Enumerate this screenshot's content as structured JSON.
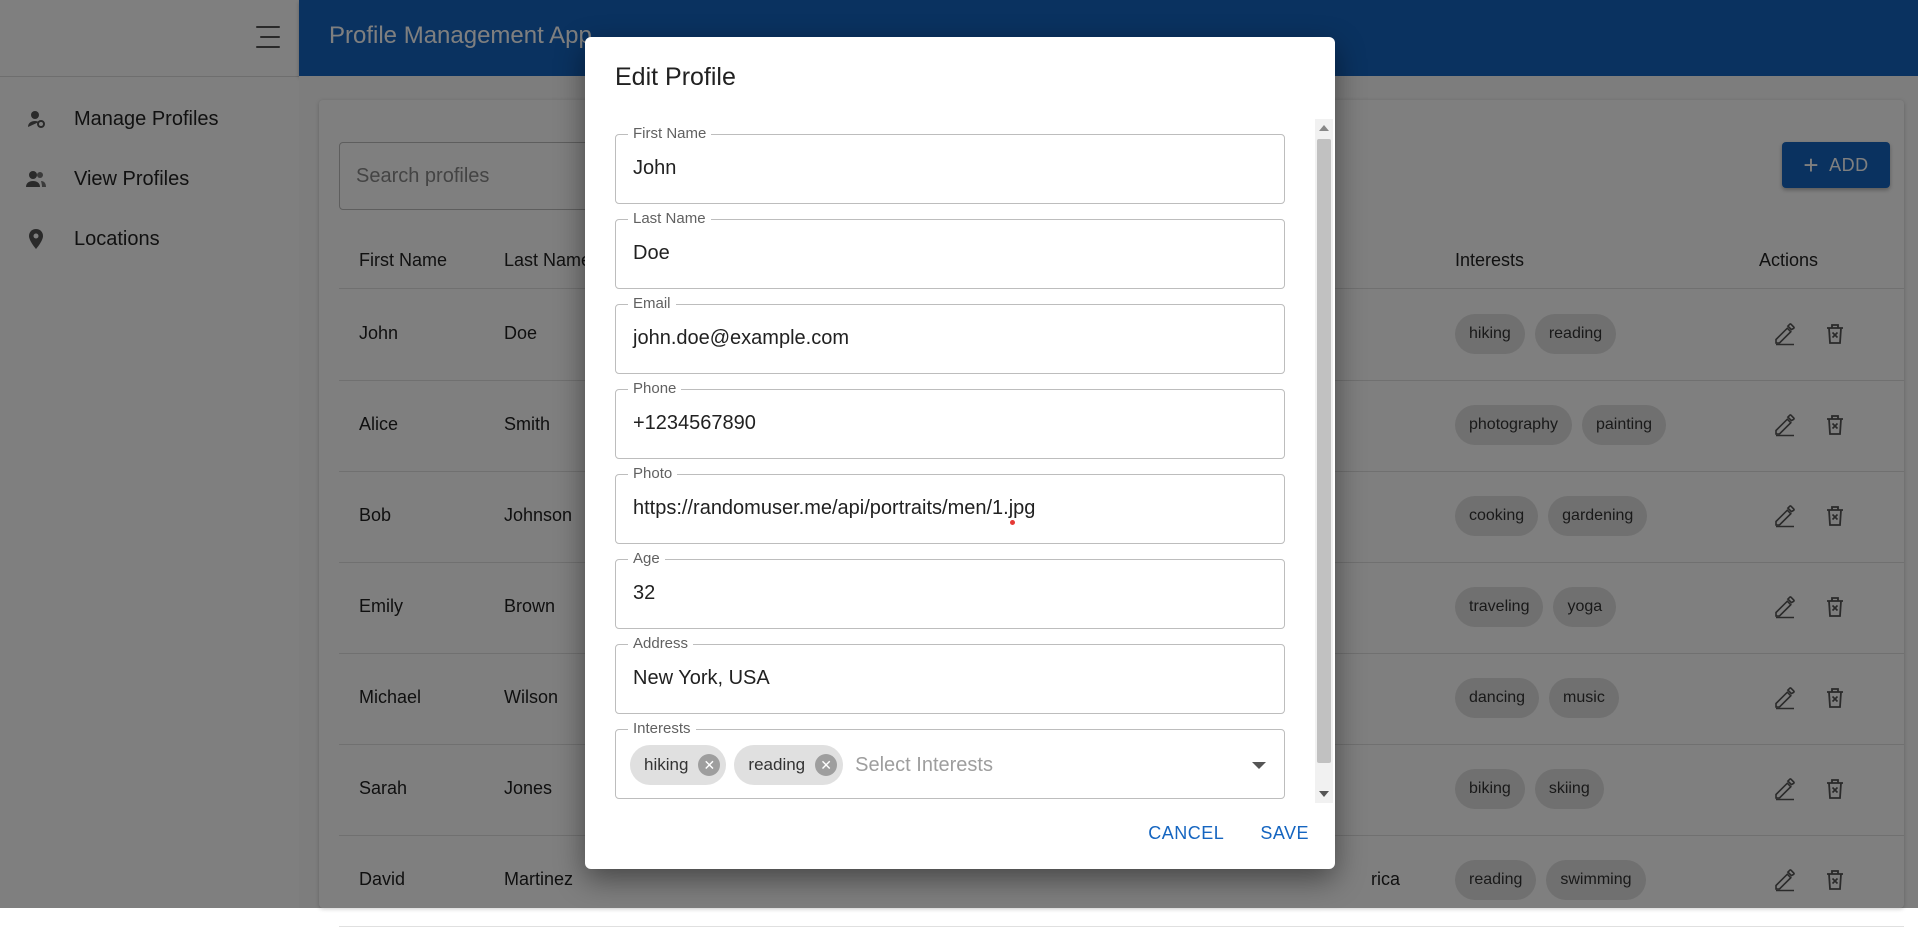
{
  "app": {
    "title": "Profile Management App"
  },
  "sidebar": {
    "items": [
      {
        "label": "Manage Profiles",
        "icon": "person-settings-icon"
      },
      {
        "label": "View Profiles",
        "icon": "people-icon"
      },
      {
        "label": "Locations",
        "icon": "location-pin-icon"
      }
    ]
  },
  "search": {
    "placeholder": "Search profiles"
  },
  "add_button": {
    "label": "ADD"
  },
  "table": {
    "columns": {
      "first_name": "First Name",
      "last_name": "Last Name",
      "interests": "Interests",
      "actions": "Actions"
    },
    "rows": [
      {
        "first_name": "John",
        "last_name": "Doe",
        "interests": [
          "hiking",
          "reading"
        ]
      },
      {
        "first_name": "Alice",
        "last_name": "Smith",
        "interests": [
          "photography",
          "painting"
        ]
      },
      {
        "first_name": "Bob",
        "last_name": "Johnson",
        "interests": [
          "cooking",
          "gardening"
        ]
      },
      {
        "first_name": "Emily",
        "last_name": "Brown",
        "interests": [
          "traveling",
          "yoga"
        ]
      },
      {
        "first_name": "Michael",
        "last_name": "Wilson",
        "interests": [
          "dancing",
          "music"
        ]
      },
      {
        "first_name": "Sarah",
        "last_name": "Jones",
        "interests": [
          "biking",
          "skiing"
        ]
      },
      {
        "first_name": "David",
        "last_name": "Martinez",
        "location_partial": "rica",
        "interests": [
          "reading",
          "swimming"
        ]
      }
    ]
  },
  "dialog": {
    "title": "Edit Profile",
    "fields": {
      "first_name": {
        "label": "First Name",
        "value": "John"
      },
      "last_name": {
        "label": "Last Name",
        "value": "Doe"
      },
      "email": {
        "label": "Email",
        "value": "john.doe@example.com"
      },
      "phone": {
        "label": "Phone",
        "value": "+1234567890"
      },
      "photo": {
        "label": "Photo",
        "value": "https://randomuser.me/api/portraits/men/1.jpg"
      },
      "age": {
        "label": "Age",
        "value": "32"
      },
      "address": {
        "label": "Address",
        "value": "New York, USA"
      },
      "interests": {
        "label": "Interests",
        "selected": [
          "hiking",
          "reading"
        ],
        "placeholder": "Select Interests"
      }
    },
    "cancel_label": "CANCEL",
    "save_label": "SAVE"
  },
  "colors": {
    "primary": "#1565c0",
    "chip": "#e0e0e0",
    "overlay": "rgba(0,0,0,0.5)"
  }
}
